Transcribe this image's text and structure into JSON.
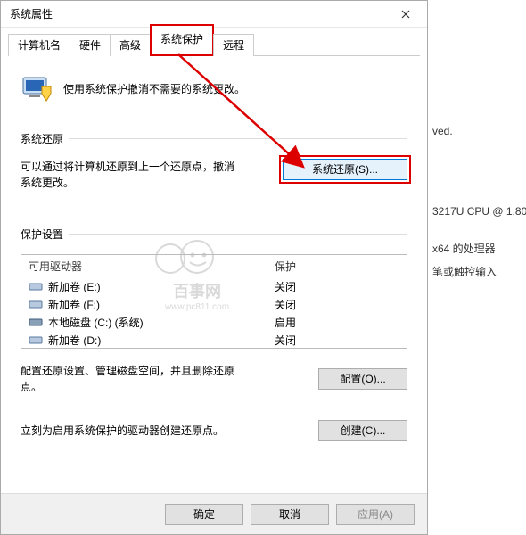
{
  "window": {
    "title": "系统属性"
  },
  "tabs": {
    "t0": "计算机名",
    "t1": "硬件",
    "t2": "高级",
    "t3": "系统保护",
    "t4": "远程"
  },
  "intro": "使用系统保护撤消不需要的系统更改。",
  "restore": {
    "heading": "系统还原",
    "text": "可以通过将计算机还原到上一个还原点，撤消系统更改。",
    "button": "系统还原(S)..."
  },
  "protection": {
    "heading": "保护设置",
    "col_drive": "可用驱动器",
    "col_prot": "保护",
    "drives": [
      {
        "name": "新加卷 (E:)",
        "status": "关闭"
      },
      {
        "name": "新加卷 (F:)",
        "status": "关闭"
      },
      {
        "name": "本地磁盘 (C:) (系统)",
        "status": "启用"
      },
      {
        "name": "新加卷 (D:)",
        "status": "关闭"
      }
    ]
  },
  "configure": {
    "text": "配置还原设置、管理磁盘空间，并且删除还原点。",
    "button": "配置(O)..."
  },
  "create": {
    "text": "立刻为启用系统保护的驱动器创建还原点。",
    "button": "创建(C)..."
  },
  "footer": {
    "ok": "确定",
    "cancel": "取消",
    "apply": "应用(A)"
  },
  "background": {
    "l1": "ved.",
    "l2": "3217U CPU @ 1.80",
    "l3": "x64 的处理器",
    "l4": "笔或触控输入"
  },
  "watermark": {
    "line1": "百事网",
    "line2": "www.pc811.com"
  }
}
